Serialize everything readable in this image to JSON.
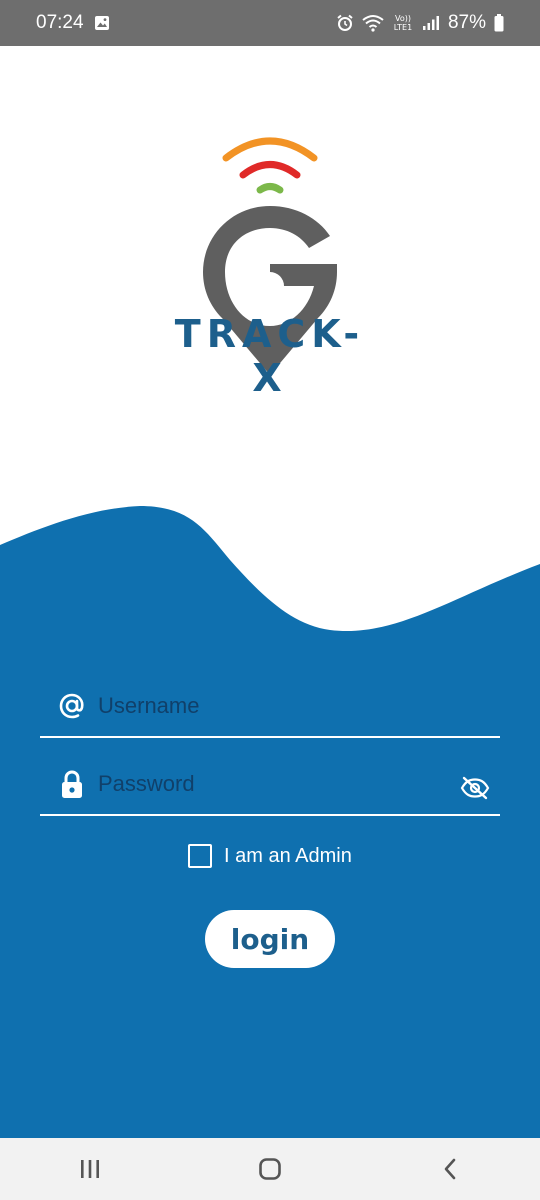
{
  "status_bar": {
    "time": "07:24",
    "battery": "87%",
    "network_badge_top": "Vo))",
    "network_badge_bottom": "LTE1"
  },
  "app": {
    "brand_name": "TRACK-X",
    "colors": {
      "primary_blue": "#0f70af",
      "brand_text": "#1d5f8c",
      "logo_gray": "#5f5f5f",
      "signal_orange": "#f29325",
      "signal_red": "#e02a28",
      "signal_green": "#7cb84a"
    }
  },
  "form": {
    "username": {
      "placeholder": "Username",
      "value": "",
      "icon": "at-sign-icon"
    },
    "password": {
      "placeholder": "Password",
      "value": "",
      "icon": "lock-icon",
      "toggle_icon": "eye-off-icon"
    },
    "admin_checkbox": {
      "label": "I am an Admin",
      "checked": false
    },
    "login_label": "login"
  },
  "nav_bar": {
    "items": [
      "recent-apps-icon",
      "home-icon",
      "back-icon"
    ]
  }
}
